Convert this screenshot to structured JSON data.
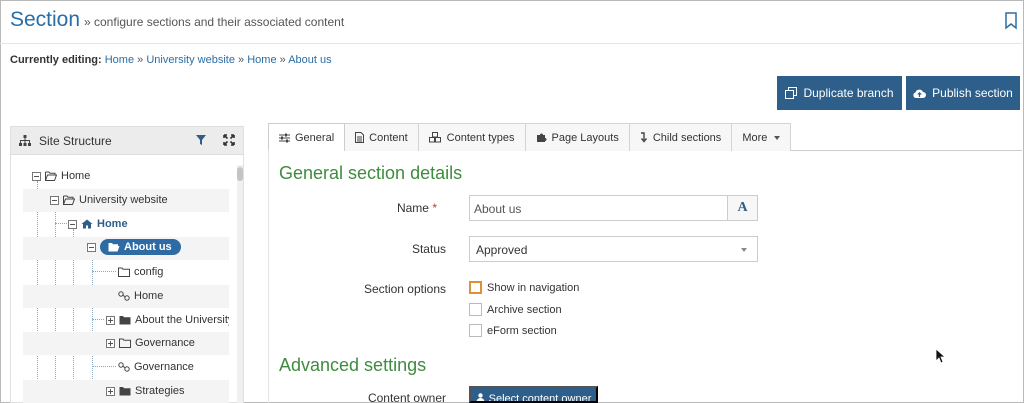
{
  "header": {
    "title": "Section",
    "subtitle": "» configure sections and their associated content"
  },
  "editing": {
    "label": "Currently editing:",
    "crumbs": [
      "Home",
      "University website",
      "Home",
      "About us"
    ],
    "separator": "»"
  },
  "actions": {
    "duplicate": "Duplicate branch",
    "publish": "Publish section"
  },
  "site_structure": {
    "title": "Site Structure",
    "tree": [
      {
        "label": "Home"
      },
      {
        "label": "University website"
      },
      {
        "label": "Home"
      },
      {
        "label": "About us"
      },
      {
        "label": "config"
      },
      {
        "label": "Home"
      },
      {
        "label": "About the University"
      },
      {
        "label": "Governance"
      },
      {
        "label": "Governance"
      },
      {
        "label": "Strategies"
      }
    ]
  },
  "tabs": [
    {
      "label": "General",
      "icon": "sliders-icon"
    },
    {
      "label": "Content",
      "icon": "document-icon"
    },
    {
      "label": "Content types",
      "icon": "cubes-icon"
    },
    {
      "label": "Page Layouts",
      "icon": "puzzle-icon"
    },
    {
      "label": "Child sections",
      "icon": "level-down-icon"
    },
    {
      "label": "More",
      "icon": "caret-down-icon"
    }
  ],
  "form": {
    "general_heading": "General section details",
    "name_label": "Name",
    "required_mark": "*",
    "name_value": "About us",
    "name_addon": "A",
    "status_label": "Status",
    "status_value": "Approved",
    "options_label": "Section options",
    "options": [
      {
        "label": "Show in navigation",
        "checked": false,
        "focused": true
      },
      {
        "label": "Archive section",
        "checked": false,
        "focused": false
      },
      {
        "label": "eForm section",
        "checked": false,
        "focused": false
      }
    ],
    "advanced_heading": "Advanced settings",
    "owner_label": "Content owner",
    "owner_button": "Select content owner"
  },
  "colors": {
    "brand_blue": "#2e5f8a",
    "link_blue": "#2a6ea6",
    "heading_green": "#3f8b3f",
    "focus_orange": "#e08e3a"
  }
}
